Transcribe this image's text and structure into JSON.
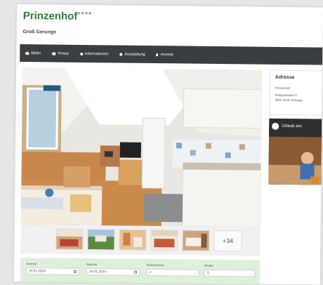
{
  "header": {
    "brand": "Prinzenhof",
    "stars": "●●●●",
    "location": "Groß Gerungs"
  },
  "nav": {
    "items": [
      {
        "label": "Bilder",
        "icon": "image-icon"
      },
      {
        "label": "Preise",
        "icon": "price-icon"
      },
      {
        "label": "Informationen",
        "icon": "info-icon"
      },
      {
        "label": "Ausstattung",
        "icon": "settings-icon"
      },
      {
        "label": "Anreise",
        "icon": "map-pin-icon"
      }
    ]
  },
  "gallery": {
    "more_count": "+34"
  },
  "address": {
    "title": "Adresse",
    "name": "Prinzenhof",
    "street": "Kehlgrasndorf 6",
    "city": "3920 Groß Gerungs"
  },
  "video": {
    "title": "Urlaub am"
  },
  "booking": {
    "arrival_label": "Anreise",
    "arrival_value": "23.01.2024",
    "departure_label": "Abreise",
    "departure_value": "25.01.2024",
    "adults_label": "Erwachsene",
    "adults_value": "2",
    "children_label": "Kinder",
    "children_value": "0"
  },
  "colors": {
    "brand": "#2f7d3b",
    "navbar": "#3b3e41",
    "booking_bg": "#dff0da"
  }
}
